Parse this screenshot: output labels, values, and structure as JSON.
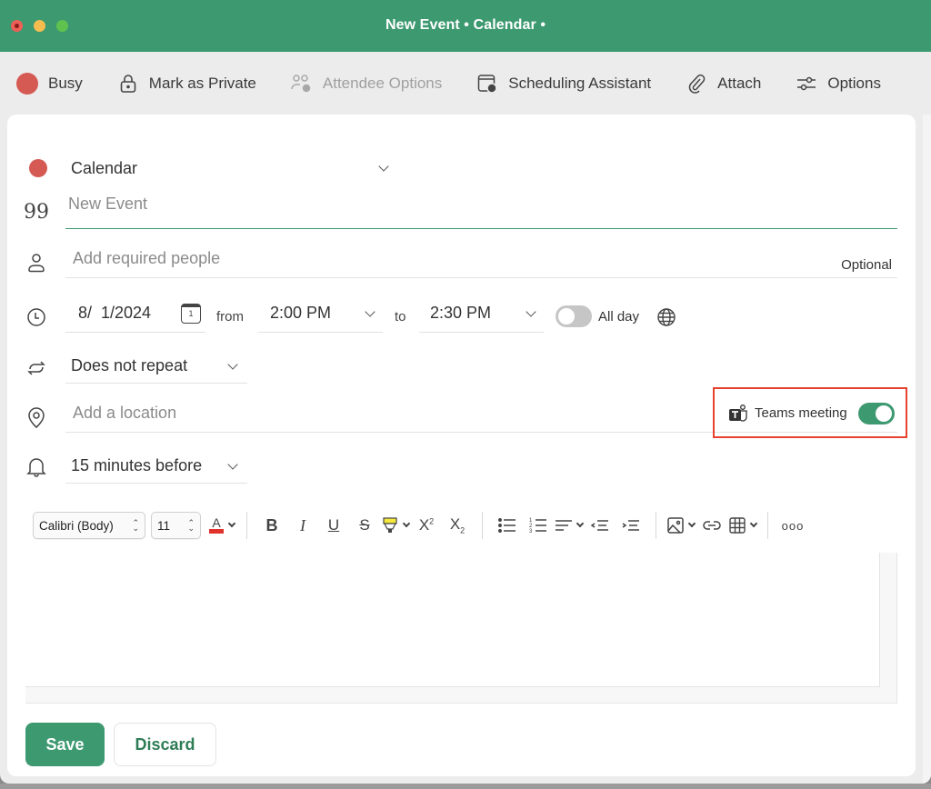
{
  "window": {
    "title": "New Event • Calendar •",
    "controls": [
      "close",
      "minimize",
      "maximize"
    ]
  },
  "toolbar": {
    "items": [
      {
        "label": "Busy",
        "icon": "busy-status-dot",
        "enabled": true
      },
      {
        "label": "Mark as Private",
        "icon": "lock-icon",
        "enabled": true
      },
      {
        "label": "Attendee Options",
        "icon": "attendee-options-icon",
        "enabled": false
      },
      {
        "label": "Scheduling Assistant",
        "icon": "scheduling-assistant-icon",
        "enabled": true
      },
      {
        "label": "Attach",
        "icon": "paperclip-icon",
        "enabled": true
      },
      {
        "label": "Options",
        "icon": "sliders-icon",
        "enabled": true
      }
    ]
  },
  "form": {
    "calendar": {
      "value": "Calendar",
      "color": "#d55a53"
    },
    "title": {
      "placeholder": "New Event",
      "value": ""
    },
    "people": {
      "placeholder": "Add required people",
      "optional_label": "Optional"
    },
    "date": {
      "value": "8/  1/2024",
      "calendar_icon_day": "1"
    },
    "from_label": "from",
    "start_time": "2:00 PM",
    "to_label": "to",
    "end_time": "2:30 PM",
    "all_day": {
      "label": "All day",
      "on": false
    },
    "repeat": {
      "value": "Does not repeat"
    },
    "location": {
      "placeholder": "Add a location"
    },
    "teams_meeting": {
      "label": "Teams meeting",
      "on": true
    },
    "reminder": {
      "value": "15 minutes before"
    }
  },
  "format_toolbar": {
    "font": "Calibri (Body)",
    "size": "11",
    "font_color": "#e0322b",
    "highlight_color": "#f6e93b",
    "buttons": [
      "bold",
      "italic",
      "underline",
      "strikethrough",
      "highlight",
      "superscript",
      "subscript",
      "bulleted-list",
      "numbered-list",
      "align",
      "decrease-indent",
      "increase-indent",
      "insert-picture",
      "link",
      "table",
      "more"
    ],
    "more_label": "ooo"
  },
  "footer": {
    "save_label": "Save",
    "discard_label": "Discard"
  },
  "colors": {
    "accent": "#3d9970",
    "highlight_box": "#e6422e",
    "busy": "#d55a53"
  }
}
